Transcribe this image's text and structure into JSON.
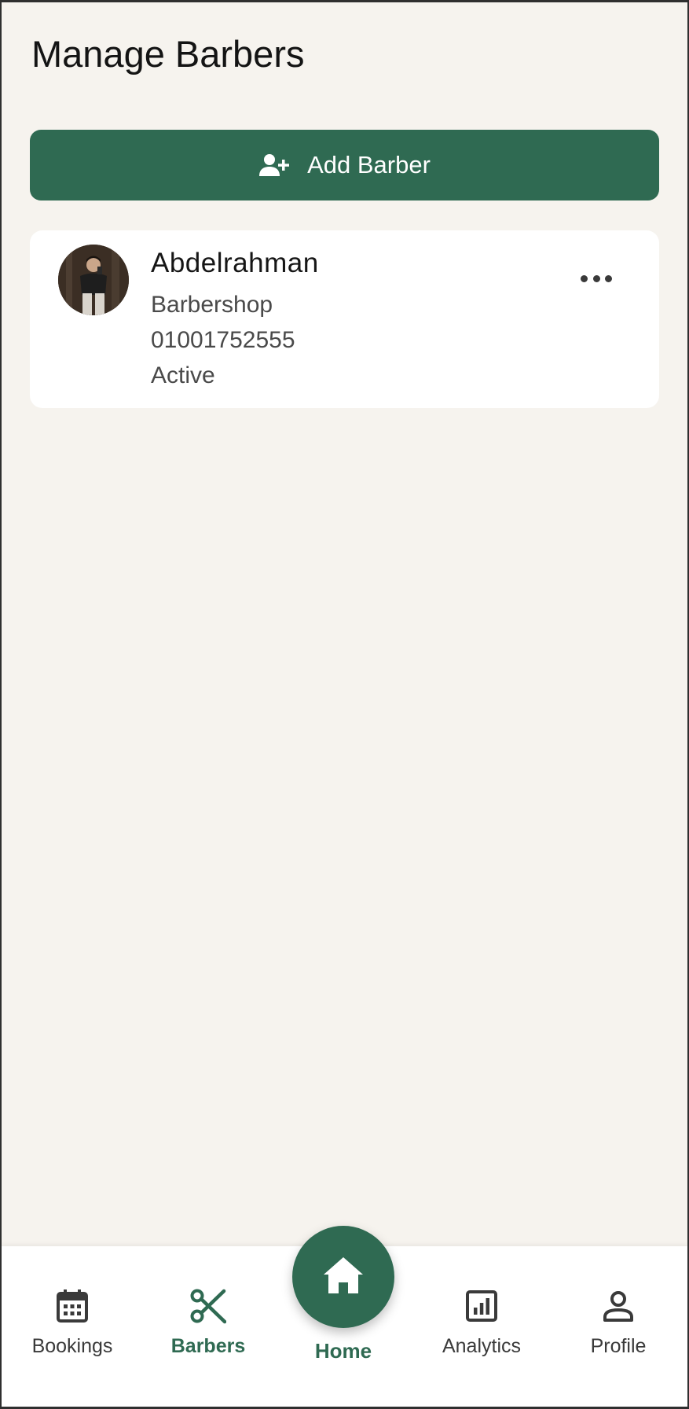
{
  "header": {
    "title": "Manage Barbers"
  },
  "actions": {
    "add_label": "Add Barber",
    "add_icon": "person-add-icon"
  },
  "barbers": [
    {
      "name": "Abdelrahman",
      "shop": "Barbershop",
      "phone": "01001752555",
      "status": "Active",
      "avatar": "avatar-photo",
      "menu_icon": "more-horizontal-icon"
    }
  ],
  "bottom_nav": {
    "items": [
      {
        "label": "Bookings",
        "icon": "calendar-icon"
      },
      {
        "label": "Barbers",
        "icon": "scissors-icon",
        "active": true
      },
      {
        "label": "Home",
        "icon": "home-icon"
      },
      {
        "label": "Analytics",
        "icon": "bar-chart-icon"
      },
      {
        "label": "Profile",
        "icon": "user-icon"
      }
    ]
  },
  "colors": {
    "accent": "#2f6a52",
    "background": "#f6f3ee",
    "card": "#ffffff",
    "text": "#141414"
  }
}
